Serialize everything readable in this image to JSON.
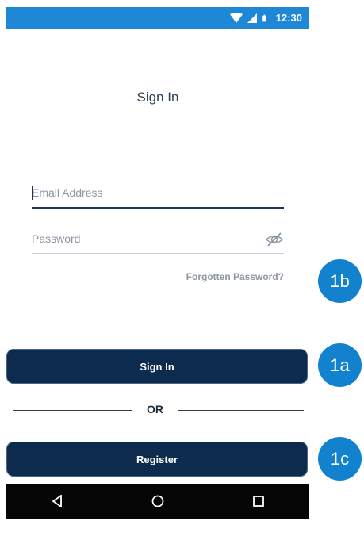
{
  "status_bar": {
    "time": "12:30",
    "icons": [
      "wifi-icon",
      "signal-icon",
      "battery-icon"
    ],
    "color": "#1e88d6"
  },
  "screen": {
    "title": "Sign In"
  },
  "form": {
    "email_placeholder": "Email Address",
    "password_placeholder": "Password",
    "forgot_label": "Forgotten Password?"
  },
  "actions": {
    "signin_label": "Sign In",
    "divider_label": "OR",
    "register_label": "Register",
    "button_color": "#0d2b4f"
  },
  "nav_bar": {
    "icons": [
      "back-icon",
      "home-icon",
      "recents-icon"
    ]
  },
  "callouts": {
    "c1b": "1b",
    "c1a": "1a",
    "c1c": "1c",
    "color": "#1282cf"
  }
}
